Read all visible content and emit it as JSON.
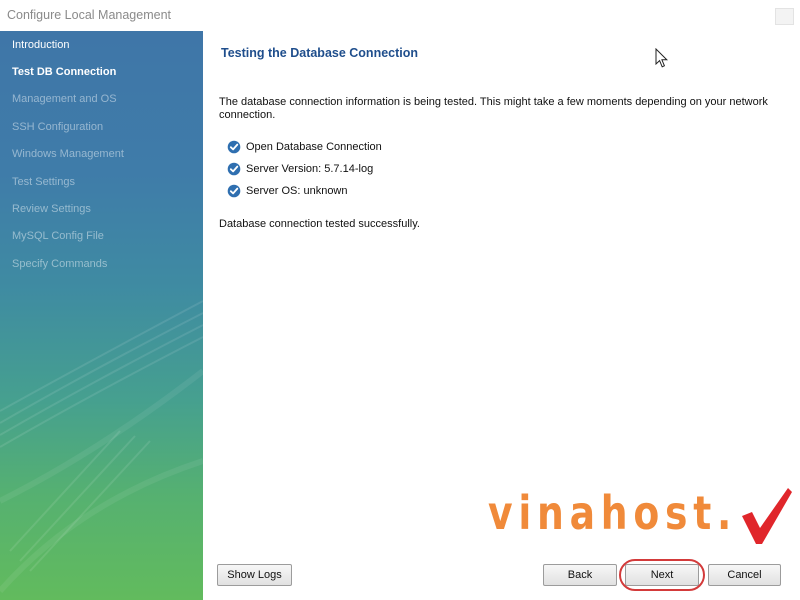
{
  "window": {
    "title": "Configure Local Management"
  },
  "sidebar": {
    "items": [
      {
        "label": "Introduction",
        "state": "done"
      },
      {
        "label": "Test DB Connection",
        "state": "active"
      },
      {
        "label": "Management and OS",
        "state": "pending"
      },
      {
        "label": "SSH Configuration",
        "state": "pending"
      },
      {
        "label": "Windows Management",
        "state": "pending"
      },
      {
        "label": "Test Settings",
        "state": "pending"
      },
      {
        "label": "Review Settings",
        "state": "pending"
      },
      {
        "label": "MySQL Config File",
        "state": "pending"
      },
      {
        "label": "Specify Commands",
        "state": "pending"
      }
    ]
  },
  "main": {
    "heading": "Testing the Database Connection",
    "description": "The database connection information is being tested. This might take a few moments depending on your network connection.",
    "checks": [
      {
        "label": "Open Database Connection",
        "checked": true
      },
      {
        "label": "Server Version: 5.7.14-log",
        "checked": true
      },
      {
        "label": "Server OS: unknown",
        "checked": true
      }
    ],
    "result": "Database connection tested successfully."
  },
  "buttons": {
    "show_logs": "Show Logs",
    "back": "Back",
    "next": "Next",
    "cancel": "Cancel"
  },
  "watermark": {
    "text": "vinahost."
  },
  "colors": {
    "accent": "#1f4e8c",
    "check": "#2f6fb0",
    "watermark_orange": "#f08a3a",
    "watermark_red": "#e0262b",
    "highlight_ring": "#d33a3a"
  }
}
